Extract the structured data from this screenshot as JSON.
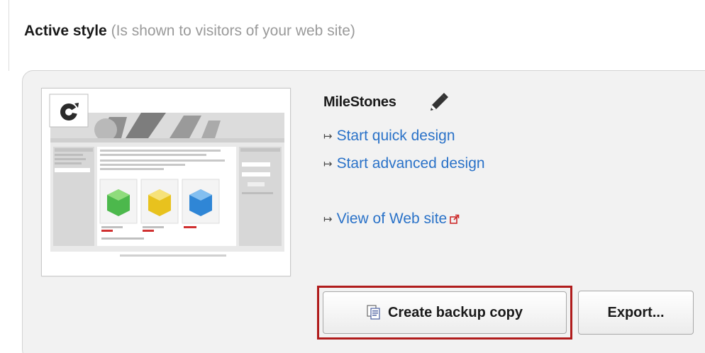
{
  "section": {
    "heading": "Active style",
    "heading_note": "(Is shown to visitors of your web site)"
  },
  "active_style": {
    "name": "MileStones",
    "edit_icon": "pencil-icon",
    "preview_icon": "refresh-icon",
    "links": [
      {
        "label": "Start quick design",
        "icon": "arrow-right-icon"
      },
      {
        "label": "Start advanced design",
        "icon": "arrow-right-icon"
      },
      {
        "label": "View of Web site",
        "icon": "arrow-right-icon",
        "trailing_icon": "external-link-icon"
      }
    ]
  },
  "actions": {
    "backup_label": "Create backup copy",
    "backup_icon": "document-copy-icon",
    "export_label": "Export..."
  },
  "colors": {
    "link": "#2a72c8",
    "highlight": "#b01c1c",
    "panel": "#f2f2f2",
    "note": "#9a9a9a"
  }
}
